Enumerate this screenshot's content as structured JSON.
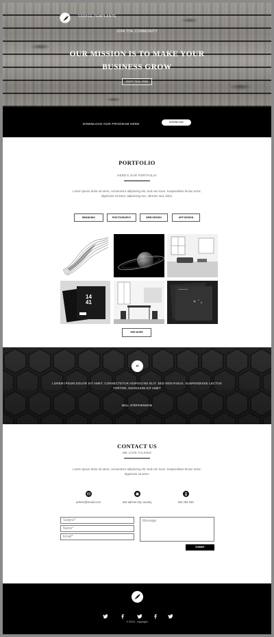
{
  "hero": {
    "brand": "CODICE TEMPLANTE",
    "subtitle": "JOIN THE COMMUNITY",
    "title_line1": "OUR MISSION IS TO MAKE YOUR",
    "title_line2": "BUSINESS GROW",
    "cta_label": "START TRIAL FREE"
  },
  "download": {
    "text": "DOWNLOAD OUR PROGRAM HERE",
    "button_label": "DOWNLOAD"
  },
  "portfolio": {
    "title": "PORTFOLIO",
    "subtitle": "HERE'S OUR PORTFOLIO",
    "paragraph": "Lorem ipsum dolor sit amet, consectetur adipiscing elit. Sed nen risus. Suspendisse lectus tortor, dignissim sit amet, adipiscing nec, ultricies sed, dolor.",
    "filters": [
      "BRANDING",
      "PHOTOGRAPHY",
      "WEB DESIGN",
      "APP DESIGN"
    ],
    "tile_caption": "14\n41",
    "see_more_label": "SEE MORE"
  },
  "testimonial": {
    "quote_mark": "“",
    "text": "LOREM IPSUM DOLOR SIT AMET, CONSECTETUR ADIPISCING ELIT. SED NON RISUS. SUSPENDISSE LECTUS TORTOR, DIGNISSIM SIT AMET",
    "author": "WILL STEPHENSON"
  },
  "contact": {
    "title": "CONTACT US",
    "subtitle": "WE LOVE TALKING",
    "paragraph": "Lorem ipsum dolor sit amet, consectetur adipiscing elit. Sed non risus. Suspendisse lectus tortor, dignissim sit amet.",
    "email": "adress@email.com",
    "address": "333 adress city country",
    "phone": "333 333 333",
    "subject_placeholder": "Subject*",
    "name_placeholder": "Name*",
    "email_placeholder": "Email*",
    "message_placeholder": "Message",
    "submit_label": "SUBMIT"
  },
  "footer": {
    "copyright": "© 2015 - copyright",
    "social_icons": [
      "twitter-icon",
      "facebook-icon",
      "twitter-icon",
      "facebook-icon",
      "twitter-icon"
    ]
  },
  "colors": {
    "black": "#000000",
    "white": "#ffffff",
    "text_grey": "#666666"
  }
}
